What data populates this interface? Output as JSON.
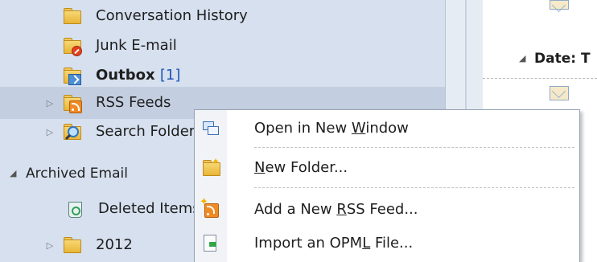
{
  "folder_pane": {
    "items": [
      {
        "label": "Conversation History",
        "icon": "folder-icon"
      },
      {
        "label": "Junk E-mail",
        "icon": "junk-email-icon"
      },
      {
        "label": "Outbox",
        "count": "[1]",
        "icon": "outbox-icon"
      },
      {
        "label": "RSS Feeds",
        "icon": "rss-feeds-icon"
      },
      {
        "label": "Search Folders",
        "icon": "search-folders-icon"
      }
    ],
    "section": {
      "label": "Archived Email"
    },
    "archive_items": [
      {
        "label": "Deleted Items",
        "icon": "deleted-items-icon"
      },
      {
        "label": "2012",
        "icon": "folder-icon"
      }
    ]
  },
  "message_pane": {
    "date_group": "Date: T"
  },
  "context_menu": {
    "items": [
      {
        "label_pre": "Open in New ",
        "label_u": "W",
        "label_post": "indow",
        "icon": "open-in-new-window-icon"
      },
      {
        "label_pre": "",
        "label_u": "N",
        "label_post": "ew Folder...",
        "icon": "new-folder-icon"
      },
      {
        "label_pre": "Add a New ",
        "label_u": "R",
        "label_post": "SS Feed...",
        "icon": "add-rss-feed-icon"
      },
      {
        "label_pre": "Import an OPM",
        "label_u": "L",
        "label_post": " File...",
        "icon": "import-opml-icon"
      }
    ]
  },
  "colors": {
    "folder_pane_bg": "#d6e0ee",
    "selected_row": "#c3cfe0",
    "unread_count": "#1f56b8"
  }
}
